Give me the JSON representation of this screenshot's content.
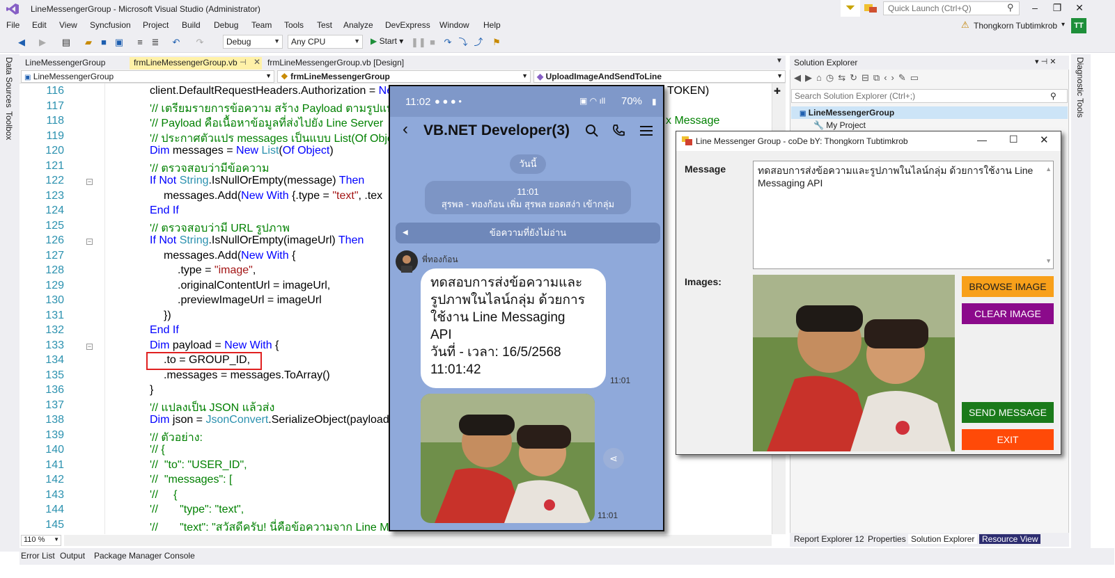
{
  "window": {
    "title": "LineMessengerGroup - Microsoft Visual Studio  (Administrator)",
    "quick_launch_placeholder": "Quick Launch (Ctrl+Q)",
    "minimize": "–",
    "restore": "❐",
    "close": "✕"
  },
  "menu": [
    "File",
    "Edit",
    "View",
    "Syncfusion",
    "Project",
    "Build",
    "Debug",
    "Team",
    "Tools",
    "Test",
    "Analyze",
    "DevExpress",
    "Window",
    "Help"
  ],
  "user": {
    "name": "Thongkorn Tubtimkrob",
    "initials": "TT"
  },
  "toolbar": {
    "config": "Debug",
    "platform": "Any CPU",
    "start": "Start"
  },
  "side_tabs": {
    "data_sources": "Data Sources",
    "toolbox": "Toolbox",
    "diagnostic": "Diagnostic Tools"
  },
  "doc_tabs": {
    "project": "LineMessengerGroup",
    "active": "frmLineMessengerGroup.vb",
    "design": "frmLineMessengerGroup.vb [Design]"
  },
  "nav": {
    "project": "LineMessengerGroup",
    "class": "frmLineMessengerGroup",
    "method": "UploadImageAndSendToLine"
  },
  "editor": {
    "zoom": "110 %",
    "lines": [
      {
        "n": "116",
        "indent": 0,
        "parts": [
          [
            "p",
            "client.DefaultRequestHeaders.Authorization = "
          ],
          [
            "kw",
            "Ne"
          ]
        ]
      },
      {
        "n": "117",
        "indent": 0,
        "parts": [
          [
            "cm",
            "'// เตรียมรายการข้อความ สร้าง Payload ตามรูปแบบ"
          ]
        ]
      },
      {
        "n": "118",
        "indent": 0,
        "parts": [
          [
            "cm",
            "'// Payload คือเนื้อหาข้อมูลที่ส่งไปยัง Line Server"
          ]
        ]
      },
      {
        "n": "119",
        "indent": 0,
        "parts": [
          [
            "cm",
            "'// ประกาศตัวแปร messages เป็นแบบ List(Of Obje"
          ]
        ]
      },
      {
        "n": "120",
        "indent": 0,
        "parts": [
          [
            "kw",
            "Dim"
          ],
          [
            "p",
            " messages = "
          ],
          [
            "kw",
            "New"
          ],
          [
            "p",
            " "
          ],
          [
            "ty",
            "List"
          ],
          [
            "p",
            "("
          ],
          [
            "kw",
            "Of Object"
          ],
          [
            "p",
            ")"
          ]
        ]
      },
      {
        "n": "121",
        "indent": 0,
        "parts": [
          [
            "cm",
            "'// ตรวจสอบว่ามีข้อความ"
          ]
        ]
      },
      {
        "n": "122",
        "indent": 0,
        "parts": [
          [
            "kw",
            "If Not"
          ],
          [
            "p",
            " "
          ],
          [
            "ty",
            "String"
          ],
          [
            "p",
            ".IsNullOrEmpty(message) "
          ],
          [
            "kw",
            "Then"
          ]
        ]
      },
      {
        "n": "123",
        "indent": 1,
        "parts": [
          [
            "p",
            "messages.Add("
          ],
          [
            "kw",
            "New With"
          ],
          [
            "p",
            " {.type = "
          ],
          [
            "st",
            "\"text\""
          ],
          [
            "p",
            ", .tex"
          ]
        ]
      },
      {
        "n": "124",
        "indent": 0,
        "parts": [
          [
            "kw",
            "End If"
          ]
        ]
      },
      {
        "n": "125",
        "indent": 0,
        "parts": [
          [
            "cm",
            "'// ตรวจสอบว่ามี URL รูปภาพ"
          ]
        ]
      },
      {
        "n": "126",
        "indent": 0,
        "parts": [
          [
            "kw",
            "If Not"
          ],
          [
            "p",
            " "
          ],
          [
            "ty",
            "String"
          ],
          [
            "p",
            ".IsNullOrEmpty(imageUrl) "
          ],
          [
            "kw",
            "Then"
          ]
        ]
      },
      {
        "n": "127",
        "indent": 1,
        "parts": [
          [
            "p",
            "messages.Add("
          ],
          [
            "kw",
            "New With"
          ],
          [
            "p",
            " {"
          ]
        ]
      },
      {
        "n": "128",
        "indent": 2,
        "parts": [
          [
            "p",
            ".type = "
          ],
          [
            "st",
            "\"image\""
          ],
          [
            "p",
            ","
          ]
        ]
      },
      {
        "n": "129",
        "indent": 2,
        "parts": [
          [
            "p",
            ".originalContentUrl = imageUrl,"
          ]
        ]
      },
      {
        "n": "130",
        "indent": 2,
        "parts": [
          [
            "p",
            ".previewImageUrl = imageUrl"
          ]
        ]
      },
      {
        "n": "131",
        "indent": 1,
        "parts": [
          [
            "p",
            "})"
          ]
        ]
      },
      {
        "n": "132",
        "indent": 0,
        "parts": [
          [
            "kw",
            "End If"
          ]
        ]
      },
      {
        "n": "133",
        "indent": 0,
        "parts": [
          [
            "kw",
            "Dim"
          ],
          [
            "p",
            " payload = "
          ],
          [
            "kw",
            "New With"
          ],
          [
            "p",
            " {"
          ]
        ]
      },
      {
        "n": "134",
        "indent": 1,
        "parts": [
          [
            "p",
            ".to = GROUP_ID,"
          ]
        ]
      },
      {
        "n": "135",
        "indent": 1,
        "parts": [
          [
            "p",
            ".messages = messages.ToArray()"
          ]
        ]
      },
      {
        "n": "136",
        "indent": 0,
        "parts": [
          [
            "p",
            "}"
          ]
        ]
      },
      {
        "n": "137",
        "indent": 0,
        "parts": [
          [
            "cm",
            "'// แปลงเป็น JSON แล้วส่ง"
          ]
        ]
      },
      {
        "n": "138",
        "indent": 0,
        "parts": [
          [
            "kw",
            "Dim"
          ],
          [
            "p",
            " json = "
          ],
          [
            "ty",
            "JsonConvert"
          ],
          [
            "p",
            ".SerializeObject(payload"
          ]
        ]
      },
      {
        "n": "139",
        "indent": 0,
        "parts": [
          [
            "cm",
            "'// ตัวอย่าง:"
          ]
        ]
      },
      {
        "n": "140",
        "indent": 0,
        "parts": [
          [
            "cm",
            "'// {"
          ]
        ]
      },
      {
        "n": "141",
        "indent": 0,
        "parts": [
          [
            "cm",
            "'//  \"to\": \"USER_ID\","
          ]
        ]
      },
      {
        "n": "142",
        "indent": 0,
        "parts": [
          [
            "cm",
            "'//  \"messages\": ["
          ]
        ]
      },
      {
        "n": "143",
        "indent": 0,
        "parts": [
          [
            "cm",
            "'//     {"
          ]
        ]
      },
      {
        "n": "144",
        "indent": 0,
        "parts": [
          [
            "cm",
            "'//       \"type\": \"text\","
          ]
        ]
      },
      {
        "n": "145",
        "indent": 0,
        "parts": [
          [
            "cm",
            "'//       \"text\": \"สวัสดีครับ! นี่คือข้อความจาก Line M"
          ]
        ]
      }
    ],
    "behind_fragments": {
      "token": "TOKEN)",
      "message": "x Message"
    }
  },
  "bottom_tabs": [
    "Error List",
    "Output",
    "Package Manager Console"
  ],
  "solution_explorer": {
    "title": "Solution Explorer",
    "search_placeholder": "Search Solution Explorer (Ctrl+;)",
    "tree": {
      "solution": "LineMessengerGroup",
      "my_project": "My Project"
    },
    "tabs": [
      "Report Explorer 12",
      "Properties",
      "Solution Explorer",
      "Resource View"
    ]
  },
  "phone": {
    "time": "11:02",
    "battery": "70%",
    "chat_title": "VB.NET Developer(3)",
    "date_pill": "วันนี้",
    "join_time": "11:01",
    "join_text": "สุรพล - ทองก้อน เพิ่ม สุรพล ยอดสง่า เข้ากลุ่ม",
    "unread": "ข้อความที่ยังไม่อ่าน",
    "sender": "พี่ทองก้อน",
    "bubble_lines": [
      "ทดสอบการส่งข้อความและ",
      "รูปภาพในไลน์กลุ่ม ด้วยการ",
      "ใช้งาน Line Messaging",
      "API",
      "วันที่ - เวลา: 16/5/2568",
      "11:01:42"
    ],
    "msg_time": "11:01",
    "img_time": "11:01"
  },
  "winform": {
    "title": "Line Messenger Group - coDe bY: Thongkorn Tubtimkrob",
    "message_label": "Message",
    "message_value": "ทดสอบการส่งข้อความและรูปภาพในไลน์กลุ่ม ด้วยการใช้งาน Line Messaging API",
    "images_label": "Images:",
    "buttons": {
      "browse": "BROWSE IMAGE",
      "clear": "CLEAR IMAGE",
      "send": "SEND MESSAGE",
      "exit": "EXIT"
    },
    "colors": {
      "browse": "#f8a01a",
      "clear": "#8b0a8b",
      "send": "#1a7a1a",
      "exit": "#ff4a08"
    }
  }
}
